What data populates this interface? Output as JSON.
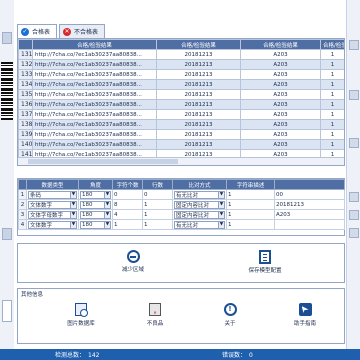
{
  "tabs": [
    {
      "label": "合格表",
      "icon": "check-circle-icon"
    },
    {
      "label": "不合格表",
      "icon": "x-circle-icon"
    }
  ],
  "main_table": {
    "columns": [
      "合格/检验结果",
      "合格/检验结果",
      "合格/检验结果",
      "合格/检验结果"
    ],
    "rows": [
      {
        "num": "131",
        "url": "http://7cha.co/?ec1ab30237aa80838...",
        "date": "20181213",
        "code": "A203",
        "v": "1"
      },
      {
        "num": "132",
        "url": "http://7cha.co/?ec1ab30237aa80838...",
        "date": "20181213",
        "code": "A203",
        "v": "1"
      },
      {
        "num": "133",
        "url": "http://7cha.co/?ec1ab30237aa80838...",
        "date": "20181213",
        "code": "A203",
        "v": "1"
      },
      {
        "num": "134",
        "url": "http://7cha.co/?ec1ab30237aa80838...",
        "date": "20181213",
        "code": "A203",
        "v": "1"
      },
      {
        "num": "135",
        "url": "http://7cha.co/?ec1ab30237aa80838...",
        "date": "20181213",
        "code": "A203",
        "v": "1"
      },
      {
        "num": "136",
        "url": "http://7cha.co/?ec1ab30237aa80838...",
        "date": "20181213",
        "code": "A203",
        "v": "1"
      },
      {
        "num": "137",
        "url": "http://7cha.co/?ec1ab30237aa80838...",
        "date": "20181213",
        "code": "A203",
        "v": "1"
      },
      {
        "num": "138",
        "url": "http://7cha.co/?ec1ab30237aa80838...",
        "date": "20181213",
        "code": "A203",
        "v": "1"
      },
      {
        "num": "139",
        "url": "http://7cha.co/?ec1ab30237aa80838...",
        "date": "20181213",
        "code": "A203",
        "v": "1"
      },
      {
        "num": "140",
        "url": "http://7cha.co/?ec1ab30237aa80838...",
        "date": "20181213",
        "code": "A203",
        "v": "1"
      },
      {
        "num": "141",
        "url": "http://7cha.co/?ec1ab30237aa80838...",
        "date": "20181213",
        "code": "A203",
        "v": "1"
      },
      {
        "num": "142",
        "url": "http://7cha.co/?ec1ab30237aa80838...",
        "date": "20181213",
        "code": "A203",
        "v": "1"
      }
    ]
  },
  "config": {
    "headers": [
      "数据类型",
      "角度",
      "字符个数",
      "行数",
      "比对方式",
      "字符串描述",
      ""
    ],
    "rows": [
      {
        "num": "1",
        "type": "条码",
        "angle": "180",
        "chars": "0",
        "lines": "0",
        "cmp": "有无比对",
        "desc": "1",
        "val": "00"
      },
      {
        "num": "2",
        "type": "文体数字",
        "angle": "180",
        "chars": "8",
        "lines": "1",
        "cmp": "固定内容比对",
        "desc": "1",
        "val": "20181213"
      },
      {
        "num": "3",
        "type": "文体字母数字",
        "angle": "180",
        "chars": "4",
        "lines": "1",
        "cmp": "固定内容比对",
        "desc": "1",
        "val": "A203"
      },
      {
        "num": "4",
        "type": "文体数字",
        "angle": "180",
        "chars": "1",
        "lines": "1",
        "cmp": "有无比对",
        "desc": "1",
        "val": ""
      }
    ]
  },
  "actions": [
    {
      "label": "减少区域",
      "icon": "minus-circle-icon"
    },
    {
      "label": "保存模型配置",
      "icon": "document-list-icon"
    }
  ],
  "other": {
    "title": "其他信息",
    "items": [
      {
        "label": "图片数据库",
        "icon": "image-search-icon"
      },
      {
        "label": "不良品",
        "icon": "defect-image-icon"
      },
      {
        "label": "关于",
        "icon": "info-icon"
      },
      {
        "label": "助手指南",
        "icon": "guide-icon"
      }
    ]
  },
  "status": {
    "check_label": "检测总数：",
    "check_value": "142",
    "error_label": "错误数：",
    "error_value": "0"
  },
  "colors": {
    "header": "#4f6ea3",
    "row_alt": "#dbe4f2",
    "accent": "#1b4f93",
    "status": "#1e5fae"
  }
}
